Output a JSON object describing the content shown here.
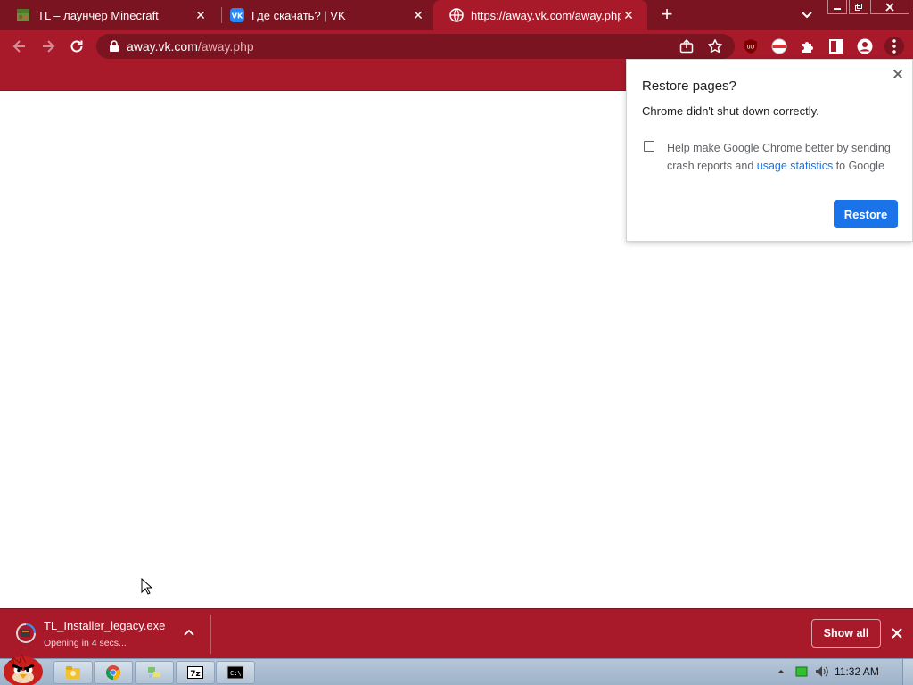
{
  "browser": {
    "tabs": [
      {
        "title": "TL – лаунчер Minecraft",
        "favicon": "minecraft-icon",
        "active": false
      },
      {
        "title": "Где скачать? | VK",
        "favicon": "vk-icon",
        "active": false
      },
      {
        "title": "https://away.vk.com/away.php",
        "favicon": "globe-icon",
        "active": true
      }
    ],
    "omnibox": {
      "host": "away.vk.com",
      "path": "/away.php"
    }
  },
  "popup": {
    "title": "Restore pages?",
    "message": "Chrome didn't shut down correctly.",
    "checkbox_text_before": "Help make Google Chrome better by sending crash reports and ",
    "checkbox_link": "usage statistics",
    "checkbox_text_after": " to Google",
    "checkbox_checked": false,
    "restore_label": "Restore"
  },
  "download": {
    "filename": "TL_Installer_legacy.exe",
    "status": "Opening in 4 secs...",
    "show_all_label": "Show all"
  },
  "taskbar": {
    "clock": "11:32 AM",
    "apps": [
      "explorer-icon",
      "chrome-icon",
      "network-icon",
      "7zip-icon",
      "cmd-icon"
    ]
  },
  "colors": {
    "theme_dark": "#7a1420",
    "theme": "#a8192a",
    "accent_blue": "#1a73e8"
  }
}
